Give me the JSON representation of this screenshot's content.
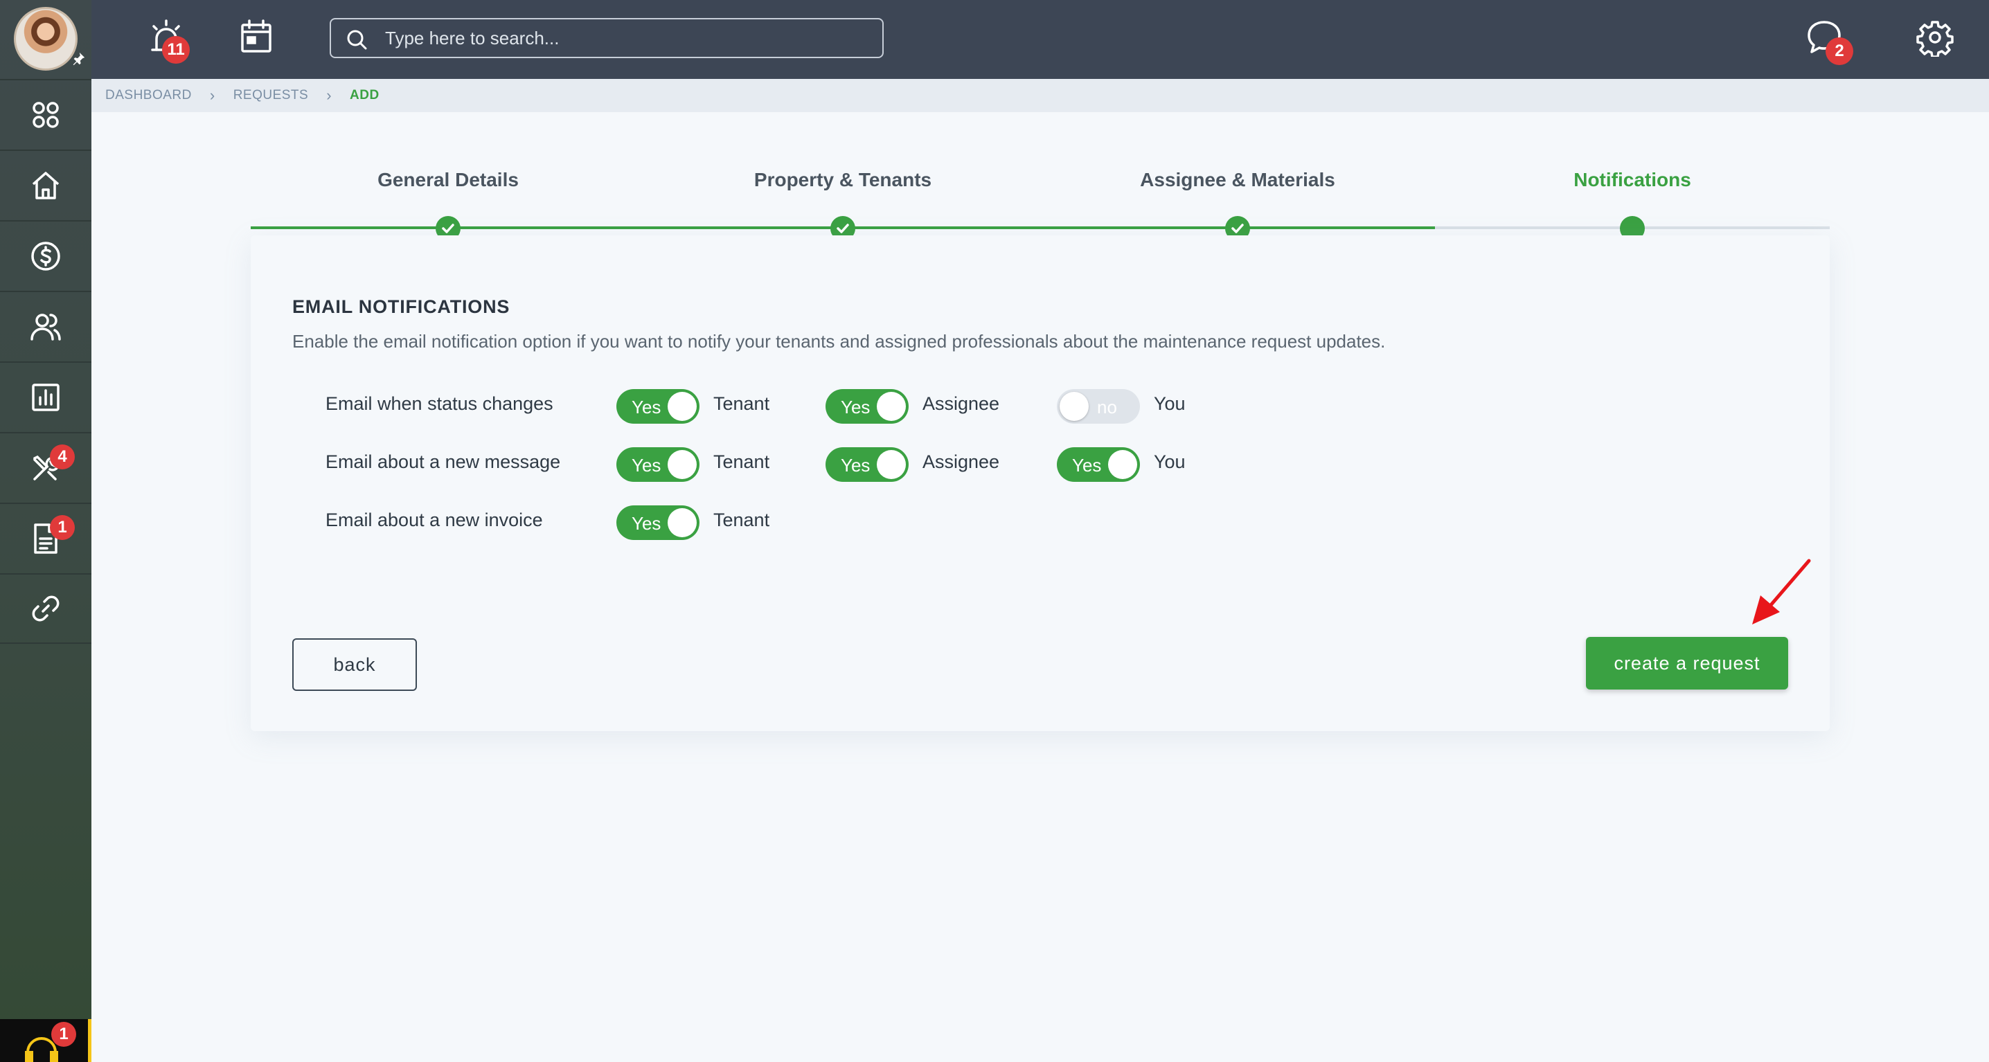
{
  "topbar": {
    "alerts_badge": "11",
    "messages_badge": "2",
    "search_placeholder": "Type here to search..."
  },
  "sidebar": {
    "items": [
      {
        "name": "dashboard",
        "icon": "grid-icon",
        "badge": ""
      },
      {
        "name": "properties",
        "icon": "home-icon",
        "badge": ""
      },
      {
        "name": "accounting",
        "icon": "dollar-icon",
        "badge": ""
      },
      {
        "name": "contacts",
        "icon": "users-icon",
        "badge": ""
      },
      {
        "name": "reports",
        "icon": "bar-chart-icon",
        "badge": ""
      },
      {
        "name": "maintenance",
        "icon": "tools-icon",
        "badge": "4"
      },
      {
        "name": "documents",
        "icon": "document-icon",
        "badge": "1"
      },
      {
        "name": "links",
        "icon": "link-icon",
        "badge": ""
      }
    ],
    "support_badge": "1"
  },
  "breadcrumb": [
    "DASHBOARD",
    "REQUESTS",
    "ADD"
  ],
  "stepper": {
    "steps": [
      "General Details",
      "Property & Tenants",
      "Assignee & Materials",
      "Notifications"
    ],
    "completed": 3,
    "active_index": 3
  },
  "notifications": {
    "title": "EMAIL NOTIFICATIONS",
    "description": "Enable the email notification option if you want to notify your tenants and assigned professionals about the maintenance request updates.",
    "rows": [
      {
        "label": "Email when status changes",
        "toggles": [
          {
            "state": "Yes",
            "on": true,
            "who": "Tenant"
          },
          {
            "state": "Yes",
            "on": true,
            "who": "Assignee"
          },
          {
            "state": "no",
            "on": false,
            "who": "You"
          }
        ]
      },
      {
        "label": "Email about a new message",
        "toggles": [
          {
            "state": "Yes",
            "on": true,
            "who": "Tenant"
          },
          {
            "state": "Yes",
            "on": true,
            "who": "Assignee"
          },
          {
            "state": "Yes",
            "on": true,
            "who": "You"
          }
        ]
      },
      {
        "label": "Email about a new invoice",
        "toggles": [
          {
            "state": "Yes",
            "on": true,
            "who": "Tenant"
          }
        ]
      }
    ]
  },
  "actions": {
    "back_label": "back",
    "create_label": "create a request"
  },
  "colors": {
    "accent": "#3aa142",
    "topbar": "#3d4655",
    "badge": "#e03a3a",
    "annotation_arrow": "#e8161b"
  }
}
